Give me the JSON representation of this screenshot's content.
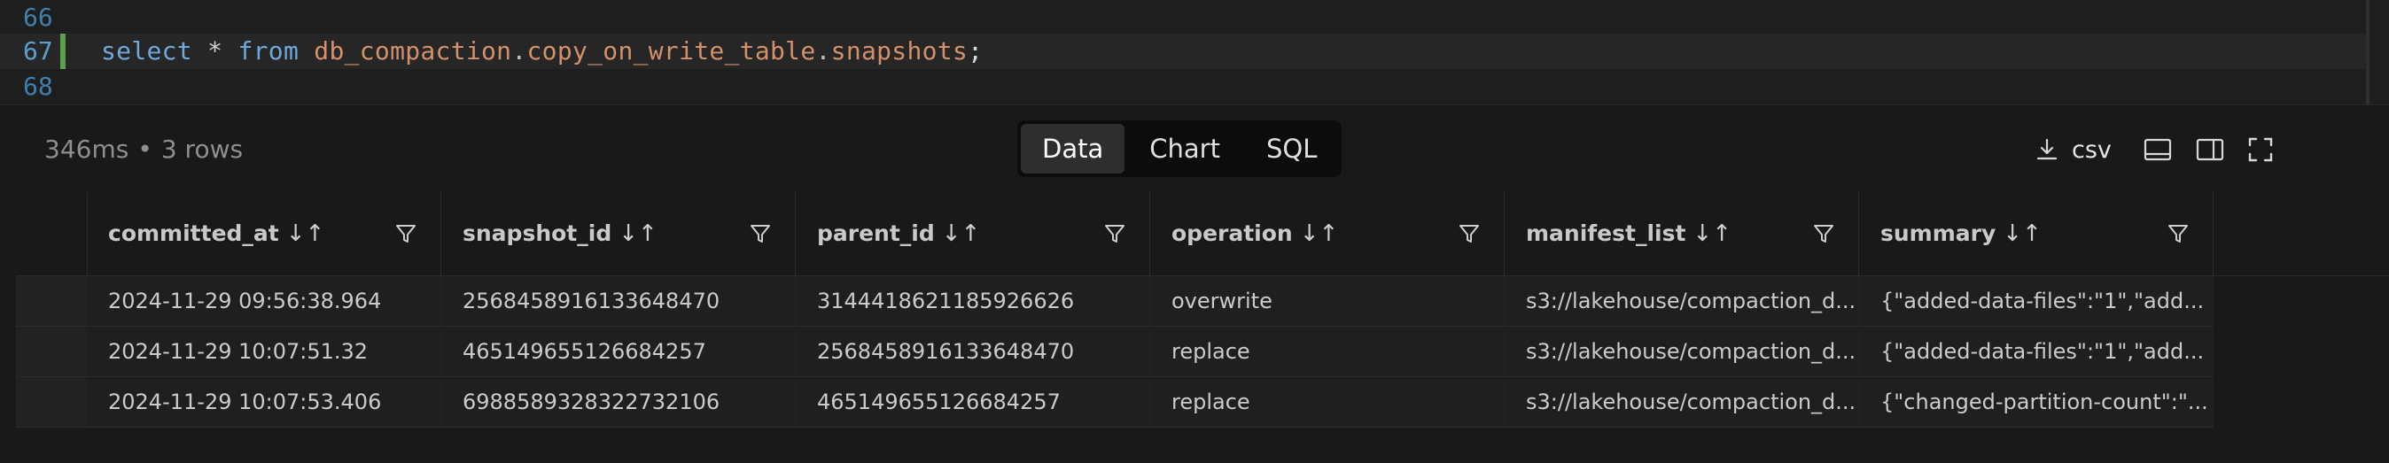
{
  "editor": {
    "lines": [
      {
        "num": "66"
      },
      {
        "num": "67"
      },
      {
        "num": "68"
      }
    ],
    "code": {
      "kw_select": "select",
      "star": "*",
      "kw_from": "from",
      "ident_db": "db_compaction",
      "dot1": ".",
      "ident_table": "copy_on_write_table",
      "dot2": ".",
      "ident_meta": "snapshots",
      "semi": ";"
    }
  },
  "results": {
    "timing": "346ms",
    "sep": "•",
    "rowcount": "3 rows",
    "tabs": [
      {
        "label": "Data",
        "active": true
      },
      {
        "label": "Chart",
        "active": false
      },
      {
        "label": "SQL",
        "active": false
      }
    ],
    "csv_label": "csv",
    "icons": [
      "download-icon",
      "layout-bottom-icon",
      "layout-side-icon",
      "fullscreen-icon"
    ]
  },
  "table": {
    "columns": [
      {
        "label": "committed_at",
        "sort": "↓↑"
      },
      {
        "label": "snapshot_id",
        "sort": "↓↑"
      },
      {
        "label": "parent_id",
        "sort": "↓↑"
      },
      {
        "label": "operation",
        "sort": "↓↑"
      },
      {
        "label": "manifest_list",
        "sort": "↓↑"
      },
      {
        "label": "summary",
        "sort": "↓↑"
      }
    ],
    "rows": [
      [
        "2024-11-29 09:56:38.964",
        "2568458916133648470",
        "3144418621185926626",
        "overwrite",
        "s3://lakehouse/compaction_d...",
        "{\"added-data-files\":\"1\",\"add..."
      ],
      [
        "2024-11-29 10:07:51.32",
        "465149655126684257",
        "2568458916133648470",
        "replace",
        "s3://lakehouse/compaction_d...",
        "{\"added-data-files\":\"1\",\"add..."
      ],
      [
        "2024-11-29 10:07:53.406",
        "6988589328322732106",
        "465149655126684257",
        "replace",
        "s3://lakehouse/compaction_d...",
        "{\"changed-partition-count\":\"..."
      ]
    ]
  },
  "colors": {
    "accent_keyword": "#6ea8dc",
    "identifier": "#d3906a",
    "modified_marker": "#5aa14d",
    "line_number": "#3f7fae"
  }
}
